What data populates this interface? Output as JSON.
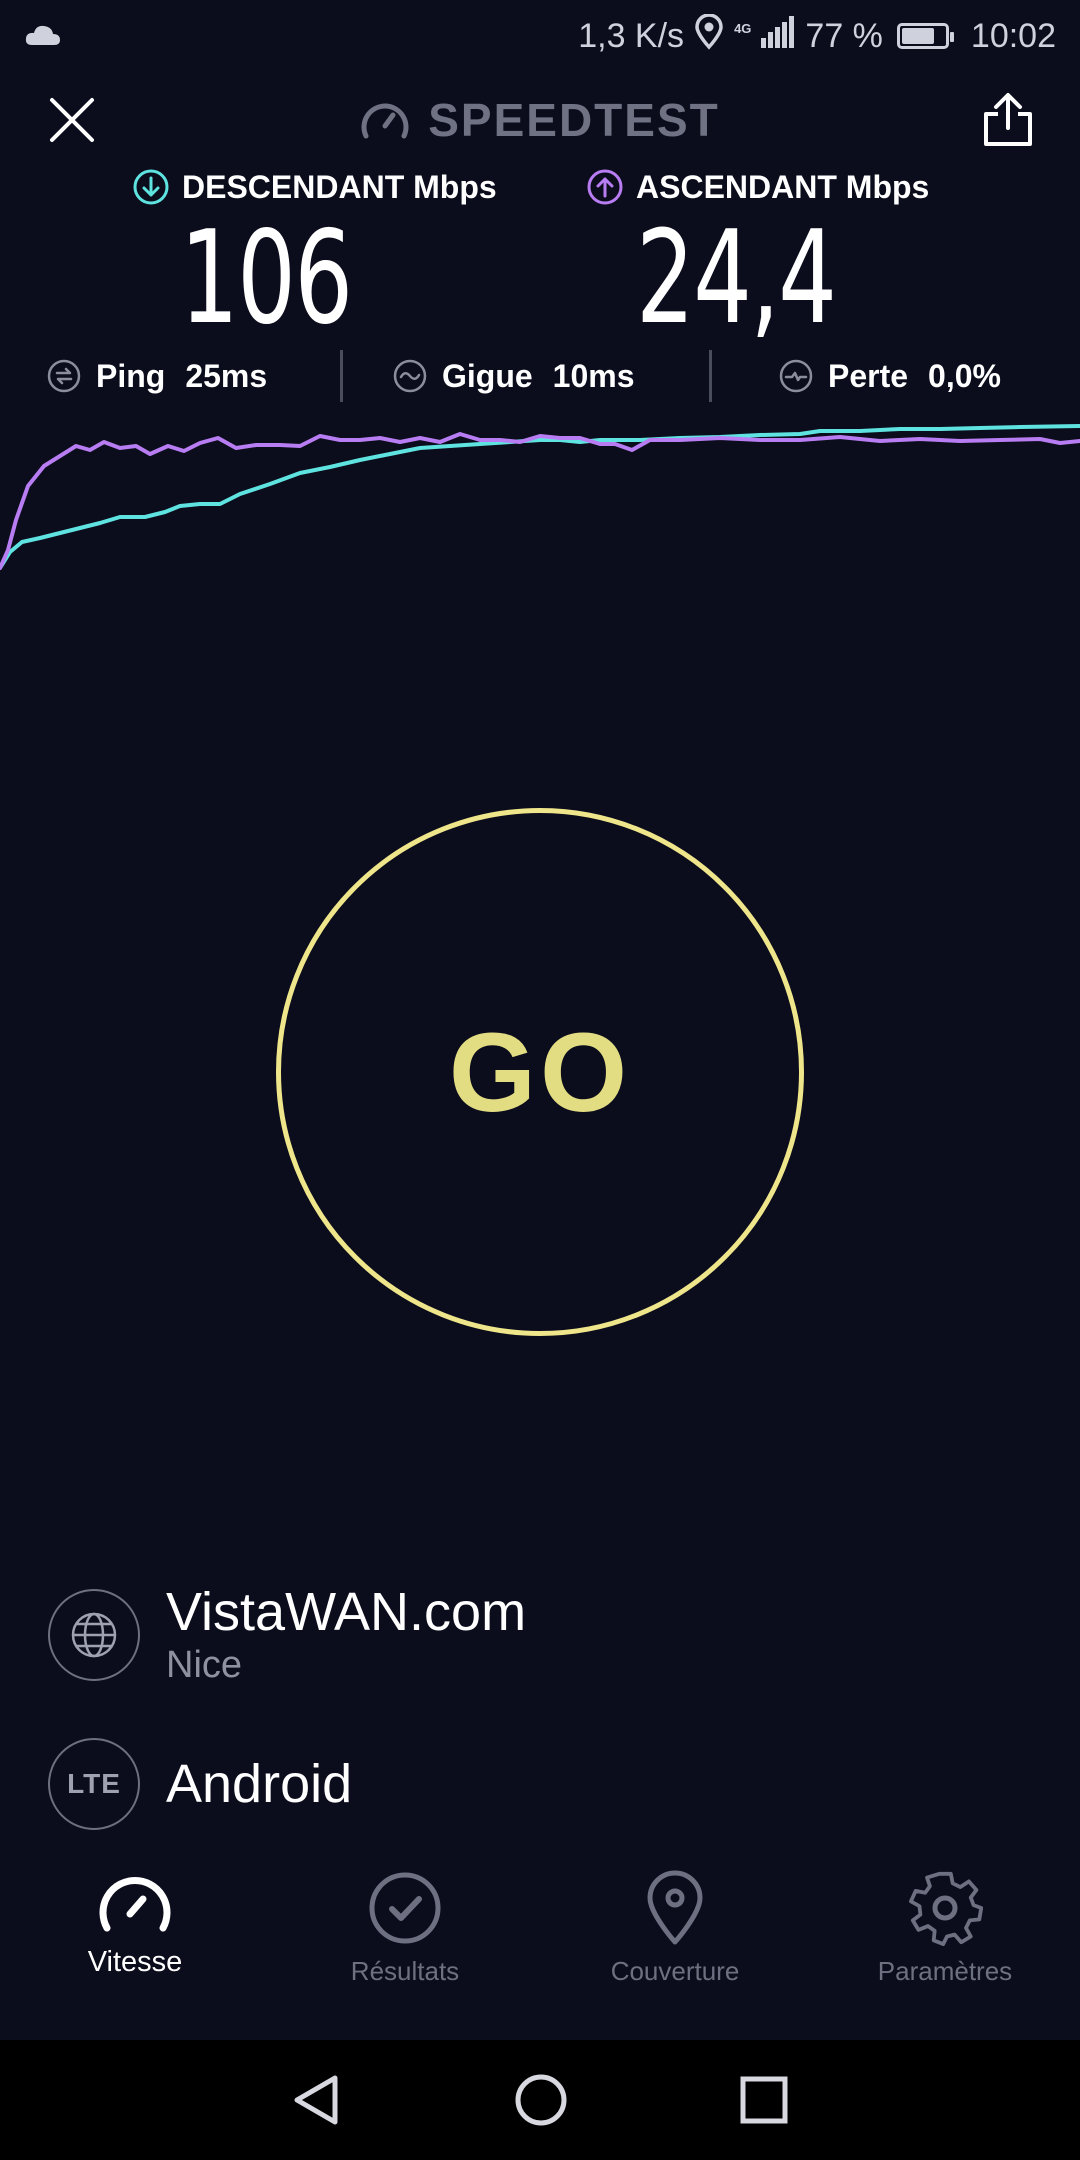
{
  "status_bar": {
    "speed": "1,3 K/s",
    "network": "4G",
    "battery": "77 %",
    "battery_level": 0.77,
    "time": "10:02",
    "icons": [
      "cloud-icon",
      "location-icon",
      "signal-icon",
      "battery-icon"
    ]
  },
  "header": {
    "title": "SPEEDTEST",
    "close_icon": "close-icon",
    "share_icon": "share-icon"
  },
  "speed": {
    "download_label": "DESCENDANT Mbps",
    "download_value": "106",
    "upload_label": "ASCENDANT Mbps",
    "upload_value": "24,4"
  },
  "stats": {
    "ping_label": "Ping",
    "ping_value": "25ms",
    "jitter_label": "Gigue",
    "jitter_value": "10ms",
    "loss_label": "Perte",
    "loss_value": "0,0%"
  },
  "graph": {
    "download_color": "#5fe3e0",
    "upload_color": "#b87df2"
  },
  "go_button": {
    "label": "GO",
    "color": "#efe58a"
  },
  "server": {
    "name": "VistaWAN.com",
    "location": "Nice"
  },
  "connection": {
    "badge": "LTE",
    "name": "Android"
  },
  "tabs": [
    {
      "label": "Vitesse",
      "icon": "speedometer-icon",
      "active": true
    },
    {
      "label": "Résultats",
      "icon": "check-circle-icon",
      "active": false
    },
    {
      "label": "Couverture",
      "icon": "map-pin-icon",
      "active": false
    },
    {
      "label": "Paramètres",
      "icon": "gear-icon",
      "active": false
    }
  ],
  "nav": [
    "back-icon",
    "home-icon",
    "recents-icon"
  ]
}
